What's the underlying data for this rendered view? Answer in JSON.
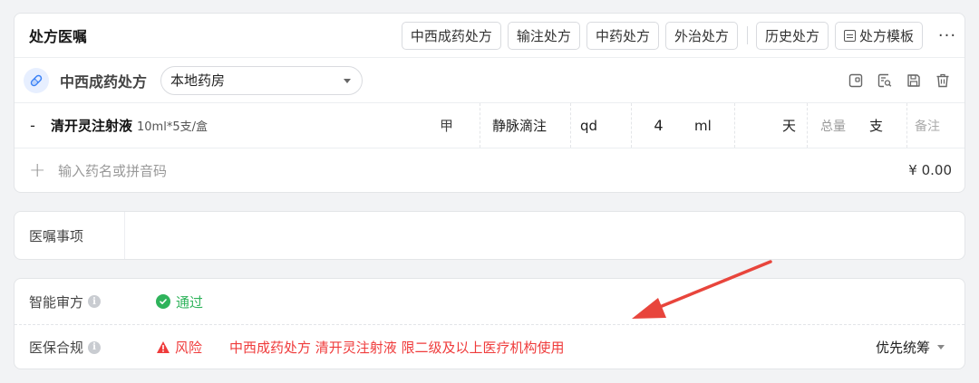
{
  "header": {
    "title": "处方医嘱",
    "tabs": [
      "中西成药处方",
      "输注处方",
      "中药处方",
      "外治处方"
    ],
    "history_label": "历史处方",
    "template_label": "处方模板",
    "more_label": "···"
  },
  "sub": {
    "title": "中西成药处方",
    "pharmacy": "本地药房"
  },
  "drug": {
    "dash": "-",
    "name": "清开灵注射液",
    "spec": "10ml*5支/盒",
    "class": "甲",
    "route": "静脉滴注",
    "freq": "qd",
    "dose": "4",
    "dose_unit": "ml",
    "days_unit": "天",
    "total_label": "总量",
    "total_unit": "支",
    "note_placeholder": "备注"
  },
  "add": {
    "plus": "+",
    "placeholder": "输入药名或拼音码",
    "price": "¥ 0.00"
  },
  "note": {
    "label": "医嘱事项"
  },
  "audit": {
    "smart_label": "智能审方",
    "smart_status": "通过",
    "insurance_label": "医保合规",
    "insurance_status": "风险",
    "insurance_message": "中西成药处方 清开灵注射液 限二级及以上医疗机构使用",
    "priority": "优先统筹",
    "info_glyph": "i"
  },
  "colors": {
    "ok": "#2fb35b",
    "risk": "#ef3b3b",
    "arrow": "#e8453c"
  }
}
